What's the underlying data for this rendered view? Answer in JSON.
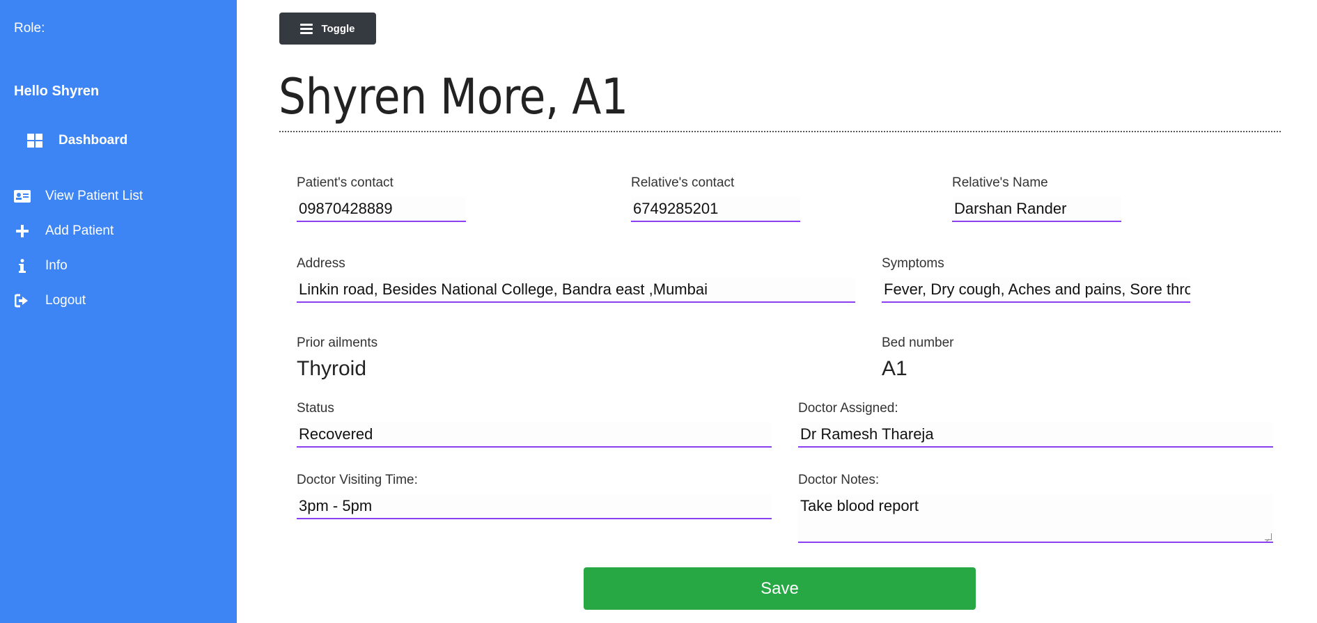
{
  "sidebar": {
    "role_label": "Role:",
    "greeting": "Hello Shyren",
    "dashboard_label": "Dashboard",
    "items": [
      {
        "label": "View Patient List",
        "icon": "id-card-icon"
      },
      {
        "label": "Add Patient",
        "icon": "plus-icon"
      },
      {
        "label": "Info",
        "icon": "info-icon"
      },
      {
        "label": "Logout",
        "icon": "logout-icon"
      }
    ],
    "color": "#3d85f5"
  },
  "toolbar": {
    "toggle_label": "Toggle"
  },
  "page": {
    "title": "Shyren More, A1"
  },
  "form": {
    "patient_contact": {
      "label": "Patient's contact",
      "value": "09870428889"
    },
    "relative_contact": {
      "label": "Relative's contact",
      "value": "6749285201"
    },
    "relative_name": {
      "label": "Relative's Name",
      "value": "Darshan Rander"
    },
    "address": {
      "label": "Address",
      "value": "Linkin road, Besides National College, Bandra east ,Mumbai"
    },
    "symptoms": {
      "label": "Symptoms",
      "value": "Fever, Dry cough, Aches and pains, Sore thro"
    },
    "prior_ailments": {
      "label": "Prior ailments",
      "value": "Thyroid"
    },
    "bed_number": {
      "label": "Bed number",
      "value": "A1"
    },
    "status": {
      "label": "Status",
      "value": "Recovered"
    },
    "doctor_assigned": {
      "label": "Doctor Assigned:",
      "value": "Dr Ramesh Thareja"
    },
    "doctor_visiting_time": {
      "label": "Doctor Visiting Time:",
      "value": "3pm - 5pm"
    },
    "doctor_notes": {
      "label": "Doctor Notes:",
      "value": "Take blood report"
    }
  },
  "actions": {
    "save_label": "Save",
    "save_color": "#28a745"
  },
  "accent_color": "#8a3ff0"
}
